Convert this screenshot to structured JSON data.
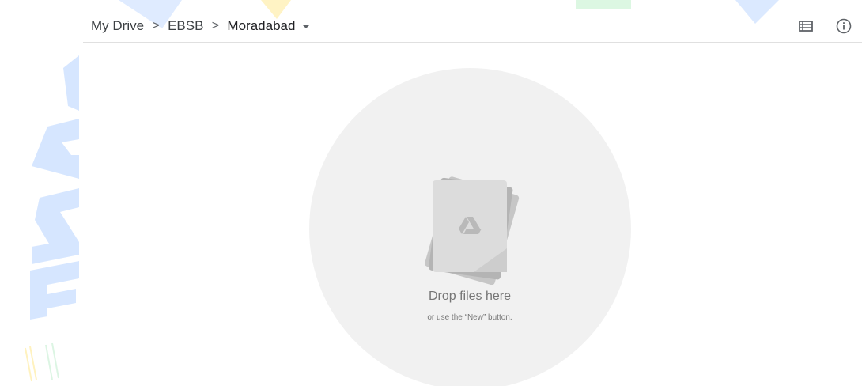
{
  "breadcrumb": {
    "items": [
      {
        "label": "My Drive"
      },
      {
        "label": "EBSB"
      },
      {
        "label": "Moradabad"
      }
    ],
    "separator": ">"
  },
  "toolbar": {
    "list_view_icon": "list-view-icon",
    "info_icon": "info-icon"
  },
  "drop_zone": {
    "title": "Drop files here",
    "subtitle": "or use the “New” button.",
    "icon": "drive-logo-icon"
  },
  "colors": {
    "drop_circle": "#f1f1f1",
    "text_muted": "#757575",
    "watermark_blue": "#d6e6ff"
  }
}
